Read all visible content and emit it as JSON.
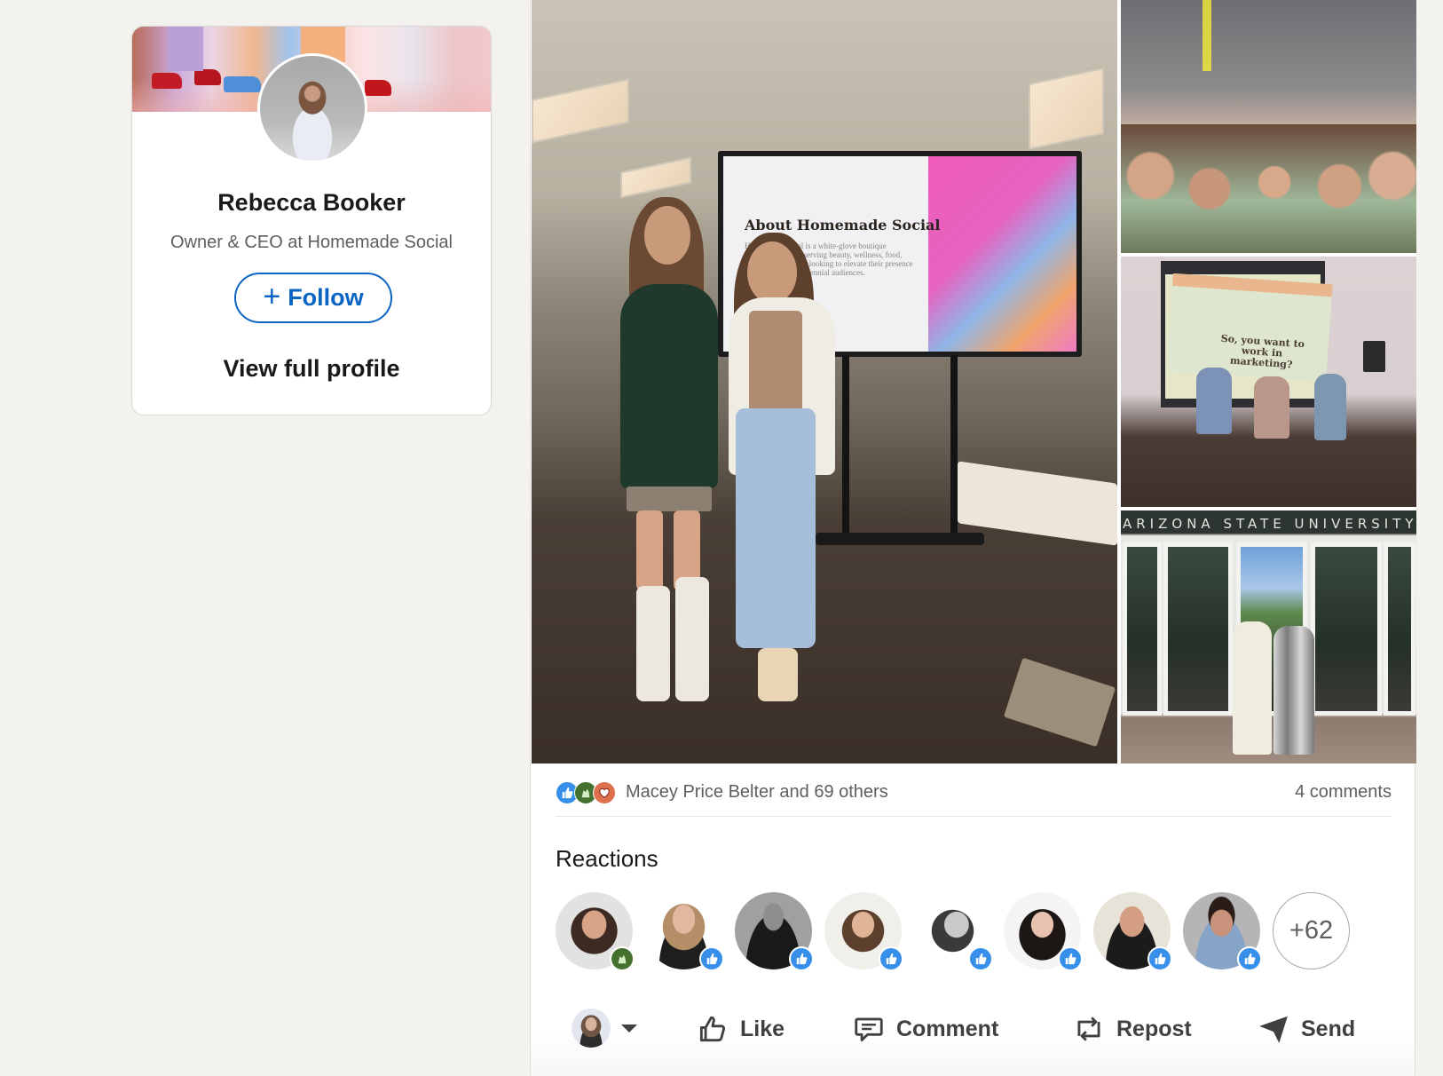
{
  "profile": {
    "name": "Rebecca Booker",
    "headline": "Owner & CEO at Homemade Social",
    "follow_label": "Follow",
    "follow_icon": "plus-icon",
    "view_profile_label": "View full profile"
  },
  "post": {
    "images": [
      {
        "name": "main-photo",
        "description": "Two women standing in front of a TV screen"
      },
      {
        "name": "group-photo",
        "description": "Large group of students posing"
      },
      {
        "name": "panel-photo",
        "description": "Panel discussion on stage"
      },
      {
        "name": "asu-entrance-photo",
        "description": "Two women at Arizona State University entrance"
      }
    ],
    "slide_title": "About Homemade Social",
    "slide_body": "Homemade Social is a white-glove boutique marketing agency serving beauty, wellness, food, and lifestyle brands looking to elevate their presence with Gen-Z and millennial audiences.",
    "panel_slide_text": "So, you want to work in marketing?",
    "building_sign": "ARIZONA STATE UNIVERSITY",
    "social_counts": {
      "reaction_icons": [
        "like-icon",
        "celebrate-icon",
        "love-icon"
      ],
      "reactors_text": "Macey Price Belter and 69 others",
      "comments_text": "4 comments"
    },
    "reactions": {
      "title": "Reactions",
      "reactors": [
        {
          "badge": "celebrate"
        },
        {
          "badge": "like"
        },
        {
          "badge": "like"
        },
        {
          "badge": "like"
        },
        {
          "badge": "like"
        },
        {
          "badge": "like"
        },
        {
          "badge": "like"
        },
        {
          "badge": "like"
        }
      ],
      "more_count": "+62"
    },
    "actions": {
      "like": "Like",
      "comment": "Comment",
      "repost": "Repost",
      "send": "Send"
    }
  },
  "colors": {
    "brand_blue": "#0a66c2",
    "like_blue": "#378fe9",
    "celebrate_green": "#44712e",
    "love_orange": "#df704d",
    "page_bg": "#f3f2ef"
  }
}
